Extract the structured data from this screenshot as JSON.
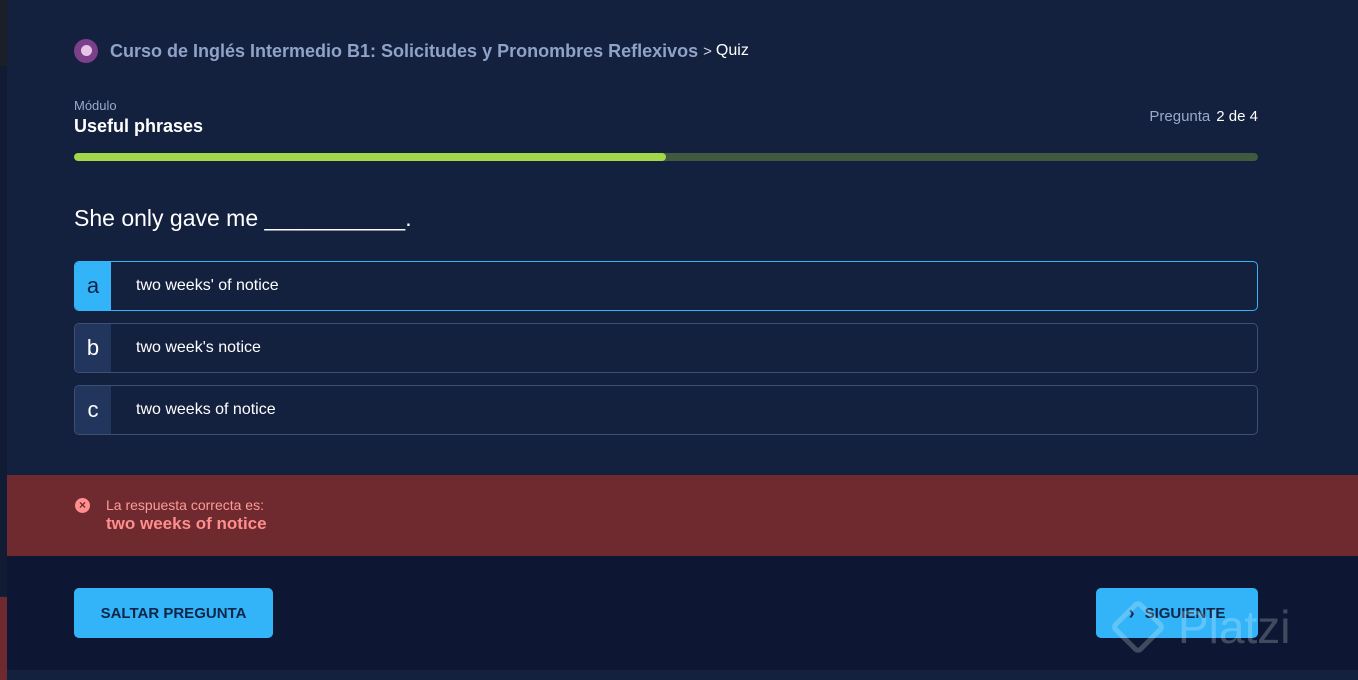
{
  "header": {
    "course_title": "Curso de Inglés Intermedio B1: Solicitudes y Pronombres Reflexivos",
    "separator": ">",
    "current": "Quiz"
  },
  "module": {
    "label": "Módulo",
    "name": "Useful phrases"
  },
  "progress": {
    "label": "Pregunta",
    "count": "2 de 4",
    "fill_percent": 50
  },
  "question": "She only gave me ___________.",
  "options": [
    {
      "letter": "a",
      "text": "two weeks' of notice",
      "selected": true
    },
    {
      "letter": "b",
      "text": "two week's notice",
      "selected": false
    },
    {
      "letter": "c",
      "text": "two weeks of notice",
      "selected": false
    }
  ],
  "result": {
    "icon": "x-circle-icon",
    "label": "La respuesta correcta es:",
    "answer": "two weeks of notice"
  },
  "buttons": {
    "skip": "SALTAR PREGUNTA",
    "next": "SIGUIENTE"
  },
  "watermark": "Platzi",
  "colors": {
    "accent": "#33b4f8",
    "progress_fill": "#a4d64a",
    "error_bg": "#6e2a2e",
    "error_text": "#ff8e8e",
    "background": "#13213f"
  }
}
